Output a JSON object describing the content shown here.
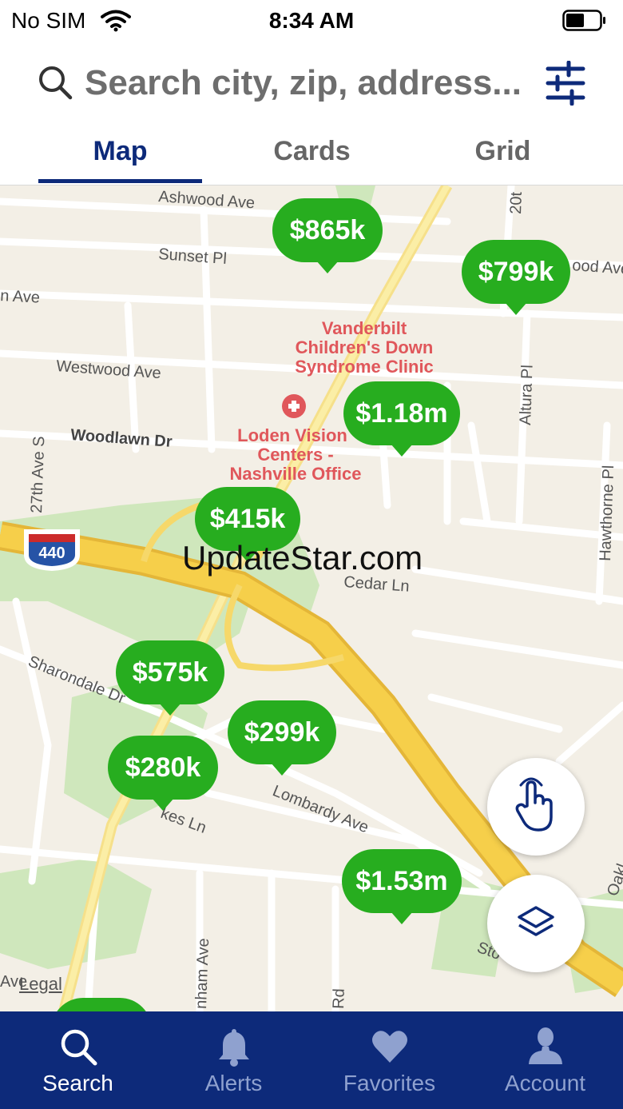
{
  "status": {
    "carrier": "No SIM",
    "time": "8:34 AM"
  },
  "search": {
    "placeholder": "Search city, zip, address..."
  },
  "tabs": [
    {
      "label": "Map",
      "active": true
    },
    {
      "label": "Cards",
      "active": false
    },
    {
      "label": "Grid",
      "active": false
    }
  ],
  "map": {
    "pins": [
      {
        "label": "$865k"
      },
      {
        "label": "$799k"
      },
      {
        "label": "$1.18m"
      },
      {
        "label": "$415k"
      },
      {
        "label": "$575k"
      },
      {
        "label": "$299k"
      },
      {
        "label": "$280k"
      },
      {
        "label": "$1.53m"
      }
    ],
    "streets": [
      "Ashwood Ave",
      "Sunset Pl",
      "n Ave",
      "Westwood Ave",
      "Woodlawn Dr",
      "27th Ave S",
      "Cedar Ln",
      "Sharondale Dr",
      "Lombardy Ave",
      "kes Ln",
      "Altura Pl",
      "Hawthorne Pl",
      "20t",
      "ood Ave",
      "nham Ave",
      "Rd",
      "Sto",
      "Oakl",
      "Ave"
    ],
    "pois": [
      "Vanderbilt Children's Down Syndrome Clinic",
      "Loden Vision Centers - Nashville Office"
    ],
    "poi_lines": [
      "Vanderbilt",
      "Children's Down",
      "Syndrome Clinic",
      "Loden Vision",
      "Centers -",
      "Nashville Office"
    ],
    "highway_shield": "440",
    "watermark": "UpdateStar.com",
    "legal": "Legal"
  },
  "nav": [
    {
      "label": "Search",
      "icon": "search-icon",
      "active": true
    },
    {
      "label": "Alerts",
      "icon": "bell-icon",
      "active": false
    },
    {
      "label": "Favorites",
      "icon": "heart-icon",
      "active": false
    },
    {
      "label": "Account",
      "icon": "person-icon",
      "active": false
    }
  ],
  "colors": {
    "brand": "#0d2a7a",
    "pin": "#27ad1f",
    "map_bg": "#f3efe6",
    "highway": "#f6cf4a",
    "park": "#cfe7bc",
    "poi": "#e0575b"
  }
}
